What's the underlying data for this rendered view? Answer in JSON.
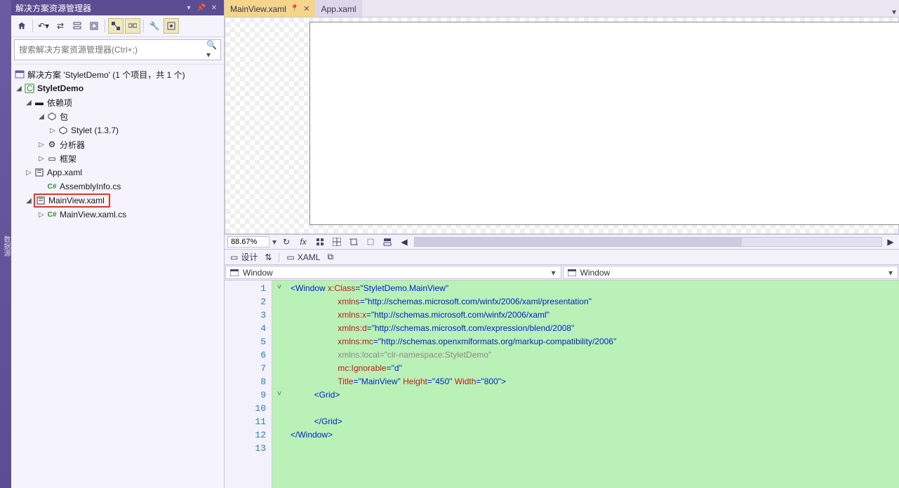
{
  "solution": {
    "panel_title": "解决方案资源管理器",
    "search_placeholder": "搜索解决方案资源管理器(Ctrl+;)",
    "root": "解决方案 'StyletDemo' (1 个项目，共 1 个)",
    "project": "StyletDemo",
    "deps": "依赖项",
    "pkg": "包",
    "stylet": "Stylet (1.3.7)",
    "analyzer": "分析器",
    "framework": "框架",
    "app": "App.xaml",
    "asm": "AssemblyInfo.cs",
    "mainview": "MainView.xaml",
    "mainview_cs": "MainView.xaml.cs"
  },
  "tabs": {
    "active": "MainView.xaml",
    "inactive": "App.xaml"
  },
  "zoom": {
    "value": "88.67%"
  },
  "view": {
    "design": "设计",
    "xaml": "XAML"
  },
  "combos": {
    "left": "Window",
    "right": "Window"
  },
  "code": {
    "linecount": 13,
    "lines": [
      {
        "indent": 0,
        "frags": [
          {
            "c": "t-brk",
            "t": "<"
          },
          {
            "c": "t-tag",
            "t": "Window "
          },
          {
            "c": "t-attr",
            "t": "x:Class"
          },
          {
            "c": "t-brk",
            "t": "=\""
          },
          {
            "c": "t-str",
            "t": "StyletDemo.MainView"
          },
          {
            "c": "t-brk",
            "t": "\""
          }
        ]
      },
      {
        "indent": 2,
        "frags": [
          {
            "c": "t-attr",
            "t": "xmlns"
          },
          {
            "c": "t-brk",
            "t": "=\""
          },
          {
            "c": "t-str",
            "t": "http://schemas.microsoft.com/winfx/2006/xaml/presentation"
          },
          {
            "c": "t-brk",
            "t": "\""
          }
        ]
      },
      {
        "indent": 2,
        "frags": [
          {
            "c": "t-attr",
            "t": "xmlns:x"
          },
          {
            "c": "t-brk",
            "t": "=\""
          },
          {
            "c": "t-str",
            "t": "http://schemas.microsoft.com/winfx/2006/xaml"
          },
          {
            "c": "t-brk",
            "t": "\""
          }
        ]
      },
      {
        "indent": 2,
        "frags": [
          {
            "c": "t-attr",
            "t": "xmlns:d"
          },
          {
            "c": "t-brk",
            "t": "=\""
          },
          {
            "c": "t-str",
            "t": "http://schemas.microsoft.com/expression/blend/2008"
          },
          {
            "c": "t-brk",
            "t": "\""
          }
        ]
      },
      {
        "indent": 2,
        "frags": [
          {
            "c": "t-attr",
            "t": "xmlns:mc"
          },
          {
            "c": "t-brk",
            "t": "=\""
          },
          {
            "c": "t-str",
            "t": "http://schemas.openxmlformats.org/markup-compatibility/2006"
          },
          {
            "c": "t-brk",
            "t": "\""
          }
        ]
      },
      {
        "indent": 2,
        "frags": [
          {
            "c": "t-gray",
            "t": "xmlns:local"
          },
          {
            "c": "t-gray",
            "t": "="
          },
          {
            "c": "t-graystr",
            "t": "\"clr-namespace:StyletDemo\""
          }
        ]
      },
      {
        "indent": 2,
        "frags": [
          {
            "c": "t-attr",
            "t": "mc:Ignorable"
          },
          {
            "c": "t-brk",
            "t": "=\""
          },
          {
            "c": "t-str",
            "t": "d"
          },
          {
            "c": "t-brk",
            "t": "\""
          }
        ]
      },
      {
        "indent": 2,
        "frags": [
          {
            "c": "t-attr",
            "t": "Title"
          },
          {
            "c": "t-brk",
            "t": "=\""
          },
          {
            "c": "t-str",
            "t": "MainView"
          },
          {
            "c": "t-brk",
            "t": "\" "
          },
          {
            "c": "t-attr",
            "t": "Height"
          },
          {
            "c": "t-brk",
            "t": "=\""
          },
          {
            "c": "t-str",
            "t": "450"
          },
          {
            "c": "t-brk",
            "t": "\" "
          },
          {
            "c": "t-attr",
            "t": "Width"
          },
          {
            "c": "t-brk",
            "t": "=\""
          },
          {
            "c": "t-str",
            "t": "800"
          },
          {
            "c": "t-brk",
            "t": "\">"
          }
        ]
      },
      {
        "indent": 1,
        "frags": [
          {
            "c": "t-brk",
            "t": "<"
          },
          {
            "c": "t-tag",
            "t": "Grid"
          },
          {
            "c": "t-brk",
            "t": ">"
          }
        ]
      },
      {
        "indent": 0,
        "frags": []
      },
      {
        "indent": 1,
        "frags": [
          {
            "c": "t-brk",
            "t": "</"
          },
          {
            "c": "t-tag",
            "t": "Grid"
          },
          {
            "c": "t-brk",
            "t": ">"
          }
        ]
      },
      {
        "indent": 0,
        "frags": [
          {
            "c": "t-brk",
            "t": "</"
          },
          {
            "c": "t-tag",
            "t": "Window"
          },
          {
            "c": "t-brk",
            "t": ">"
          }
        ]
      },
      {
        "indent": 0,
        "frags": []
      }
    ],
    "folds": [
      "˅",
      "",
      "",
      "",
      "",
      "",
      "",
      "",
      "˅",
      "",
      "",
      "",
      ""
    ]
  }
}
